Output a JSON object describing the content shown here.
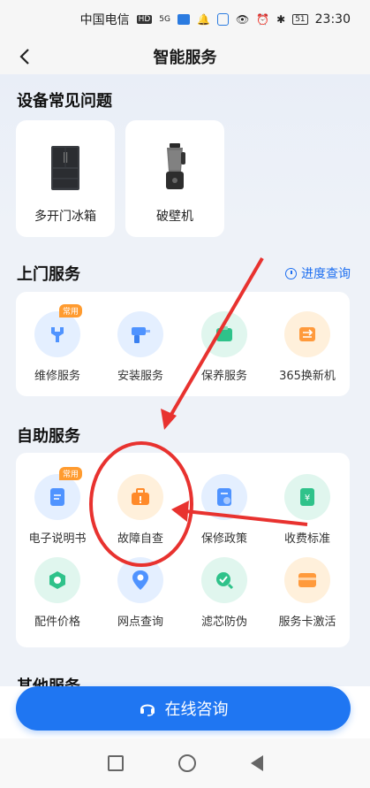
{
  "status_bar": {
    "carrier": "中国电信",
    "network_badge": "HD",
    "signal": "5G",
    "battery": "51",
    "time": "23:30"
  },
  "header": {
    "title": "智能服务",
    "back_icon": "chevron-left-icon"
  },
  "faq": {
    "title": "设备常见问题",
    "items": [
      {
        "label": "多开门冰箱",
        "icon": "fridge-icon"
      },
      {
        "label": "破壁机",
        "icon": "blender-icon"
      }
    ]
  },
  "home_service": {
    "title": "上门服务",
    "link": "进度查询",
    "items": [
      {
        "label": "维修服务",
        "icon": "wrench-icon",
        "badge": "常用",
        "color": "blue"
      },
      {
        "label": "安装服务",
        "icon": "drill-icon",
        "badge": "",
        "color": "blue"
      },
      {
        "label": "保养服务",
        "icon": "maintenance-icon",
        "badge": "",
        "color": "green"
      },
      {
        "label": "365换新机",
        "icon": "exchange-icon",
        "badge": "",
        "color": "orange"
      }
    ]
  },
  "self_service": {
    "title": "自助服务",
    "items": [
      {
        "label": "电子说明书",
        "icon": "manual-icon",
        "badge": "常用",
        "color": "blue"
      },
      {
        "label": "故障自查",
        "icon": "toolbox-icon",
        "badge": "",
        "color": "orange"
      },
      {
        "label": "保修政策",
        "icon": "policy-icon",
        "badge": "",
        "color": "blue"
      },
      {
        "label": "收费标准",
        "icon": "fee-icon",
        "badge": "",
        "color": "green"
      },
      {
        "label": "配件价格",
        "icon": "parts-icon",
        "badge": "",
        "color": "green"
      },
      {
        "label": "网点查询",
        "icon": "location-icon",
        "badge": "",
        "color": "blue"
      },
      {
        "label": "滤芯防伪",
        "icon": "verify-icon",
        "badge": "",
        "color": "green"
      },
      {
        "label": "服务卡激活",
        "icon": "card-icon",
        "badge": "",
        "color": "orange"
      }
    ]
  },
  "other_service": {
    "title": "其他服务"
  },
  "bottom": {
    "consult_label": "在线咨询",
    "consult_icon": "headset-icon"
  },
  "colors": {
    "accent": "#1f76f2",
    "badge": "#ff9b2f",
    "annotation": "#e8322f"
  }
}
